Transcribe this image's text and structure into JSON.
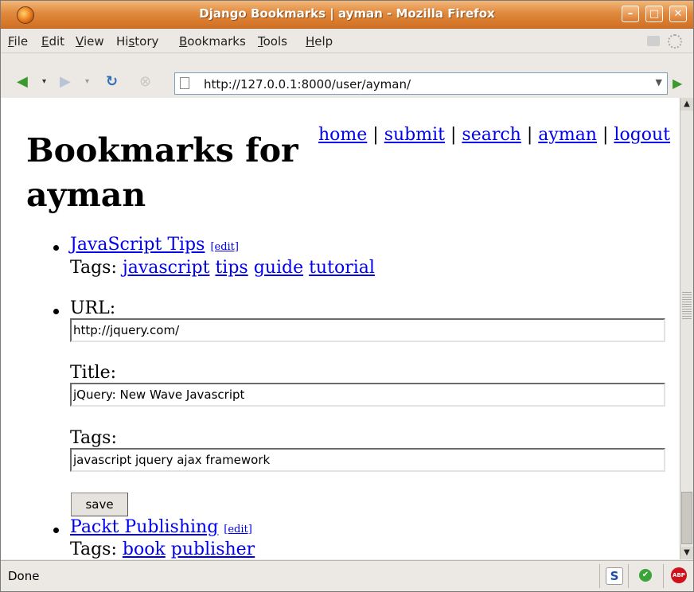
{
  "window": {
    "title": "Django Bookmarks | ayman - Mozilla Firefox"
  },
  "menu": [
    {
      "label": "File",
      "u": "F",
      "rest": "ile"
    },
    {
      "label": "Edit",
      "u": "E",
      "rest": "dit"
    },
    {
      "label": "View",
      "u": "V",
      "rest": "iew"
    },
    {
      "label": "History",
      "pre": "Hi",
      "u": "s",
      "rest": "tory"
    },
    {
      "label": "Bookmarks",
      "u": "B",
      "rest": "ookmarks"
    },
    {
      "label": "Tools",
      "u": "T",
      "rest": "ools"
    },
    {
      "label": "Help",
      "u": "H",
      "rest": "elp"
    }
  ],
  "navbar": {
    "url": "http://127.0.0.1:8000/user/ayman/"
  },
  "page": {
    "title": "Bookmarks for ayman",
    "nav": {
      "home": "home",
      "submit": "submit",
      "search": "search",
      "user": "ayman",
      "logout": "logout",
      "sep": "|"
    },
    "bookmarks": [
      {
        "title": "JavaScript Tips",
        "edit": "[edit]",
        "tags_label": "Tags:",
        "tags": [
          "javascript",
          "tips",
          "guide",
          "tutorial"
        ]
      },
      {
        "title": "Packt Publishing",
        "edit": "[edit]",
        "tags_label": "Tags:",
        "tags": [
          "book",
          "publisher"
        ]
      }
    ],
    "edit_form": {
      "url_label": "URL:",
      "url_value": "http://jquery.com/",
      "title_label": "Title:",
      "title_value": "jQuery: New Wave Javascript",
      "tags_label": "Tags:",
      "tags_value": "javascript jquery ajax framework",
      "save_label": "save"
    }
  },
  "status": {
    "text": "Done"
  }
}
